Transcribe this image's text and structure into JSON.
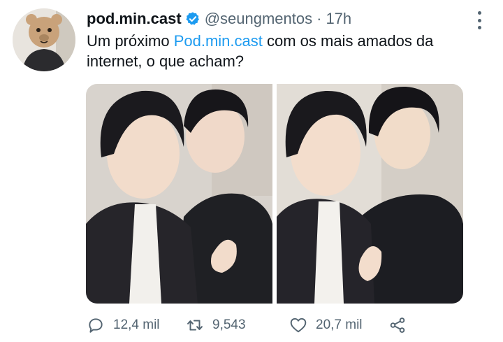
{
  "tweet": {
    "display_name": "pod.min.cast",
    "handle": "@seungmentos",
    "separator": "·",
    "time": "17h",
    "text_before": "Um próximo ",
    "mention": "Pod.min.cast",
    "text_after": " com os mais amados da internet, o que acham?"
  },
  "actions": {
    "replies": "12,4 mil",
    "retweets": "9,543",
    "likes": "20,7 mil"
  },
  "icons": {
    "verified": "verified-badge-icon",
    "more": "more-vertical-icon",
    "reply": "reply-icon",
    "retweet": "retweet-icon",
    "like": "heart-icon",
    "share": "share-icon"
  },
  "colors": {
    "accent": "#1d9bf0",
    "secondary_text": "#536471"
  }
}
